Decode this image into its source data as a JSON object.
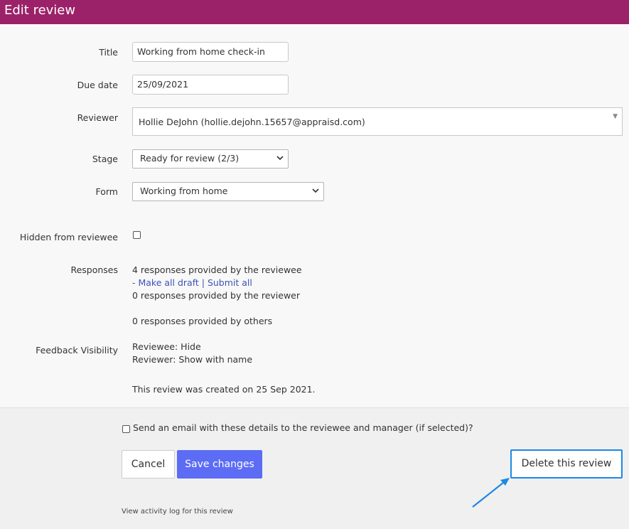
{
  "header": {
    "title": "Edit review"
  },
  "fields": {
    "title_label": "Title",
    "title_value": "Working from home check-in",
    "due_label": "Due date",
    "due_value": "25/09/2021",
    "reviewer_label": "Reviewer",
    "reviewer_value": "Hollie DeJohn (hollie.dejohn.15657@appraisd.com)",
    "stage_label": "Stage",
    "stage_value": "Ready for review (2/3)",
    "form_label": "Form",
    "form_value": "Working from home",
    "hidden_label": "Hidden from reviewee",
    "responses_label": "Responses",
    "responses_reviewee": "4 responses provided by the reviewee",
    "make_all_draft_prefix": "- ",
    "make_all_draft": "Make all draft",
    "separator": " | ",
    "submit_all": "Submit all",
    "responses_reviewer": "0 responses provided by the reviewer",
    "responses_others": "0 responses provided by others",
    "feedback_label": "Feedback Visibility",
    "feedback_reviewee": "Reviewee: Hide",
    "feedback_reviewer": "Reviewer: Show with name",
    "created_text": "This review was created on 25 Sep 2021."
  },
  "footer": {
    "email_label": "Send an email with these details to the reviewee and manager (if selected)?",
    "cancel_label": "Cancel",
    "save_label": "Save changes",
    "delete_label": "Delete this review",
    "activity_link": "View activity log for this review"
  },
  "colors": {
    "header_bg": "#9b2268",
    "save_button": "#5c6cf5",
    "delete_highlight": "#1e88e5",
    "link": "#3f51b5"
  },
  "icons": {
    "select_chevron": "chevron-down-icon",
    "reviewer_caret": "caret-down-icon",
    "annotation_arrow": "arrow-icon"
  }
}
